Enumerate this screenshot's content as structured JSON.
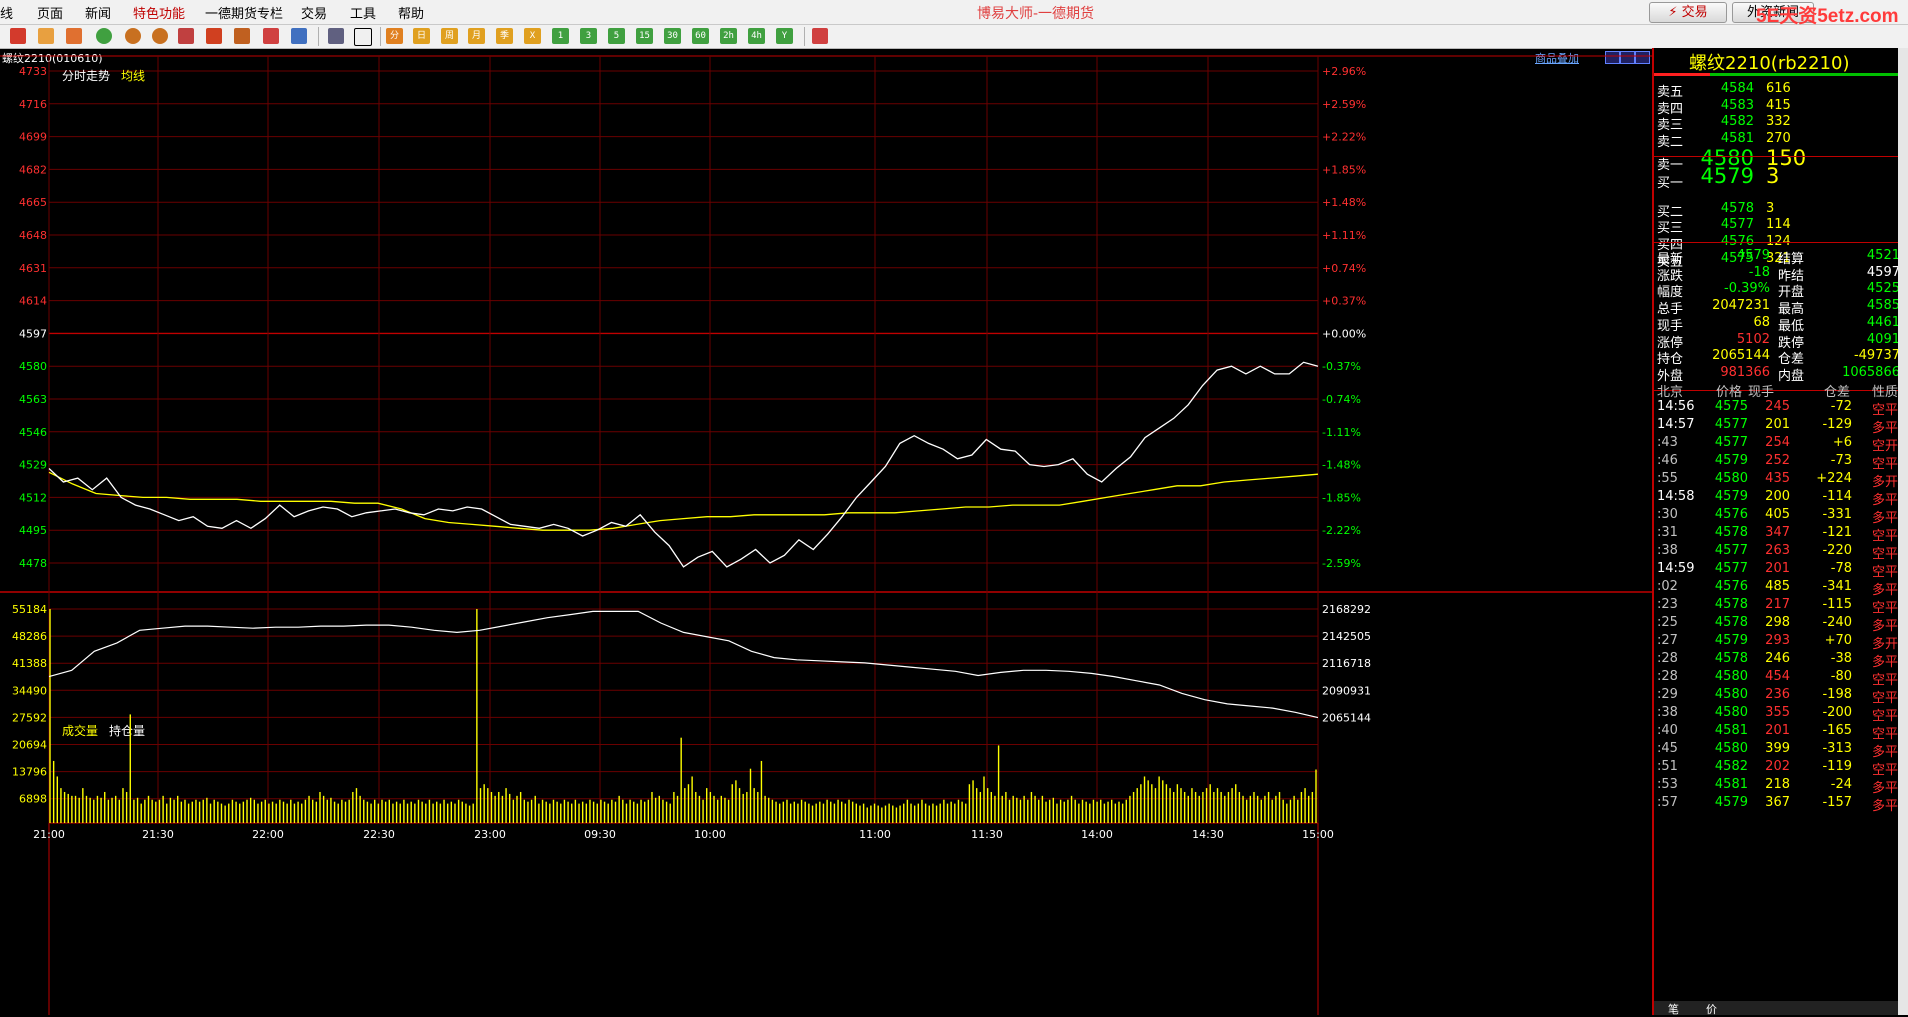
{
  "menu": {
    "items": [
      "线",
      "页面",
      "新闻",
      "特色功能",
      "一德期货专栏",
      "交易",
      "工具",
      "帮助"
    ],
    "app_title": "博易大师-一德期货",
    "trade_label": "交易",
    "news_label": "外资新闻",
    "watermark": "5E天资5etz.com"
  },
  "chart": {
    "title": "螺纹2210(010610)",
    "tab_trend": "分时走势",
    "tab_avg": "均线",
    "overlay_link": "商品叠加",
    "price_ticks": [
      "4733",
      "4716",
      "4699",
      "4682",
      "4665",
      "4648",
      "4631",
      "4614",
      "4597",
      "4580",
      "4563",
      "4546",
      "4529",
      "4512",
      "4495",
      "4478"
    ],
    "pct_ticks": [
      "+2.96%",
      "+2.59%",
      "+2.22%",
      "+1.85%",
      "+1.48%",
      "+1.11%",
      "+0.74%",
      "+0.37%",
      "+0.00%",
      "-0.37%",
      "-0.74%",
      "-1.11%",
      "-1.48%",
      "-1.85%",
      "-2.22%",
      "-2.59%"
    ],
    "vol_label": "成交量",
    "oi_label": "持仓量",
    "vol_ticks": [
      "55184",
      "48286",
      "41388",
      "34490",
      "27592",
      "20694",
      "13796",
      "6898"
    ],
    "oi_ticks": [
      "2168292",
      "2142505",
      "2116718",
      "2090931",
      "2065144"
    ],
    "time_ticks": [
      "21:00",
      "21:30",
      "22:00",
      "22:30",
      "23:00",
      "09:30",
      "10:00",
      "11:00",
      "11:30",
      "14:00",
      "14:30",
      "15:00"
    ],
    "colors": {
      "grid": "#800000",
      "axis": "#c00000",
      "price": "#ffffff",
      "avg": "#ffff00",
      "vol": "#ffff00",
      "up": "#ff3030",
      "down": "#00ff00"
    }
  },
  "chart_data": {
    "type": "line",
    "title": "螺纹2210(010610)",
    "prev_settle": 4597,
    "ylim": [
      4478,
      4733
    ],
    "series": [
      {
        "name": "分时走势",
        "values": [
          4527,
          4520,
          4522,
          4516,
          4522,
          4512,
          4508,
          4506,
          4503,
          4500,
          4502,
          4497,
          4496,
          4500,
          4496,
          4501,
          4508,
          4502,
          4505,
          4507,
          4506,
          4502,
          4504,
          4505,
          4506,
          4504,
          4503,
          4506,
          4505,
          4507,
          4506,
          4502,
          4498,
          4497,
          4496,
          4498,
          4496,
          4492,
          4495,
          4499,
          4497,
          4503,
          4494,
          4487,
          4476,
          4481,
          4484,
          4476,
          4480,
          4485,
          4478,
          4482,
          4490,
          4485,
          4493,
          4502,
          4512,
          4520,
          4528,
          4540,
          4544,
          4540,
          4537,
          4532,
          4534,
          4542,
          4537,
          4536,
          4529,
          4528,
          4529,
          4532,
          4524,
          4520,
          4527,
          4533,
          4543,
          4548,
          4553,
          4560,
          4570,
          4578,
          4580,
          4576,
          4580,
          4576,
          4576,
          4582,
          4580
        ]
      },
      {
        "name": "均线",
        "values": [
          4525,
          4519,
          4514,
          4513,
          4512,
          4512,
          4511,
          4511,
          4511,
          4510,
          4510,
          4510,
          4510,
          4509,
          4509,
          4506,
          4501,
          4499,
          4498,
          4497,
          4496,
          4495,
          4495,
          4495,
          4496,
          4498,
          4500,
          4501,
          4502,
          4502,
          4503,
          4503,
          4503,
          4503,
          4504,
          4504,
          4504,
          4505,
          4506,
          4507,
          4507,
          4508,
          4508,
          4508,
          4510,
          4512,
          4514,
          4516,
          4518,
          4518,
          4520,
          4521,
          4522,
          4523,
          4524
        ]
      }
    ]
  },
  "quote": {
    "title": "螺纹2210(rb2210)",
    "asks": [
      {
        "label": "卖五",
        "price": "4584",
        "vol": "616"
      },
      {
        "label": "卖四",
        "price": "4583",
        "vol": "415"
      },
      {
        "label": "卖三",
        "price": "4582",
        "vol": "332"
      },
      {
        "label": "卖二",
        "price": "4581",
        "vol": "270"
      },
      {
        "label": "卖一",
        "price": "4580",
        "vol": "150"
      }
    ],
    "bids": [
      {
        "label": "买一",
        "price": "4579",
        "vol": "3"
      },
      {
        "label": "买二",
        "price": "4578",
        "vol": "3"
      },
      {
        "label": "买三",
        "price": "4577",
        "vol": "114"
      },
      {
        "label": "买四",
        "price": "4576",
        "vol": "124"
      },
      {
        "label": "买五",
        "price": "4575",
        "vol": "321"
      }
    ],
    "stats": [
      {
        "l1": "最新",
        "v1": "4579",
        "c1": "#00ff00",
        "l2": "结算",
        "v2": "4521",
        "c2": "#00ff00"
      },
      {
        "l1": "涨跌",
        "v1": "-18",
        "c1": "#00ff00",
        "l2": "昨结",
        "v2": "4597",
        "c2": "#ffffff"
      },
      {
        "l1": "幅度",
        "v1": "-0.39%",
        "c1": "#00ff00",
        "l2": "开盘",
        "v2": "4525",
        "c2": "#00ff00"
      },
      {
        "l1": "总手",
        "v1": "2047231",
        "c1": "#ffff00",
        "l2": "最高",
        "v2": "4585",
        "c2": "#00ff00"
      },
      {
        "l1": "现手",
        "v1": "68",
        "c1": "#ffff00",
        "l2": "最低",
        "v2": "4461",
        "c2": "#00ff00"
      },
      {
        "l1": "涨停",
        "v1": "5102",
        "c1": "#ff3030",
        "l2": "跌停",
        "v2": "4091",
        "c2": "#00ff00"
      },
      {
        "l1": "持仓",
        "v1": "2065144",
        "c1": "#ffff00",
        "l2": "仓差",
        "v2": "-49737",
        "c2": "#ffff00"
      },
      {
        "l1": "外盘",
        "v1": "981366",
        "c1": "#ff3030",
        "l2": "内盘",
        "v2": "1065866",
        "c2": "#00ff00"
      }
    ],
    "ticks_header": [
      "北京",
      "价格",
      "现手",
      "仓差",
      "性质"
    ],
    "ticks": [
      {
        "t": "14:56",
        "p": "4575",
        "v": "245",
        "d": "-72",
        "n": "空平"
      },
      {
        "t": "14:57",
        "p": "4577",
        "v": "201",
        "d": "-129",
        "n": "多平"
      },
      {
        "t": ":43",
        "p": "4577",
        "v": "254",
        "d": "+6",
        "n": "空开"
      },
      {
        "t": ":46",
        "p": "4579",
        "v": "252",
        "d": "-73",
        "n": "空平"
      },
      {
        "t": ":55",
        "p": "4580",
        "v": "435",
        "d": "+224",
        "n": "多开"
      },
      {
        "t": "14:58",
        "p": "4579",
        "v": "200",
        "d": "-114",
        "n": "多平"
      },
      {
        "t": ":30",
        "p": "4576",
        "v": "405",
        "d": "-331",
        "n": "多平"
      },
      {
        "t": ":31",
        "p": "4578",
        "v": "347",
        "d": "-121",
        "n": "空平"
      },
      {
        "t": ":38",
        "p": "4577",
        "v": "263",
        "d": "-220",
        "n": "空平"
      },
      {
        "t": "14:59",
        "p": "4577",
        "v": "201",
        "d": "-78",
        "n": "空平"
      },
      {
        "t": ":02",
        "p": "4576",
        "v": "485",
        "d": "-341",
        "n": "多平"
      },
      {
        "t": ":23",
        "p": "4578",
        "v": "217",
        "d": "-115",
        "n": "空平"
      },
      {
        "t": ":25",
        "p": "4578",
        "v": "298",
        "d": "-240",
        "n": "多平"
      },
      {
        "t": ":27",
        "p": "4579",
        "v": "293",
        "d": "+70",
        "n": "多开"
      },
      {
        "t": ":28",
        "p": "4578",
        "v": "246",
        "d": "-38",
        "n": "多平"
      },
      {
        "t": ":28",
        "p": "4580",
        "v": "454",
        "d": "-80",
        "n": "空平"
      },
      {
        "t": ":29",
        "p": "4580",
        "v": "236",
        "d": "-198",
        "n": "空平"
      },
      {
        "t": ":38",
        "p": "4580",
        "v": "355",
        "d": "-200",
        "n": "空平"
      },
      {
        "t": ":40",
        "p": "4581",
        "v": "201",
        "d": "-165",
        "n": "空平"
      },
      {
        "t": ":45",
        "p": "4580",
        "v": "399",
        "d": "-313",
        "n": "多平"
      },
      {
        "t": ":51",
        "p": "4582",
        "v": "202",
        "d": "-119",
        "n": "空平"
      },
      {
        "t": ":53",
        "p": "4581",
        "v": "218",
        "d": "-24",
        "n": "多平"
      },
      {
        "t": ":57",
        "p": "4579",
        "v": "367",
        "d": "-157",
        "n": "多平"
      }
    ],
    "bottom_tabs": [
      "笔",
      "价"
    ]
  }
}
